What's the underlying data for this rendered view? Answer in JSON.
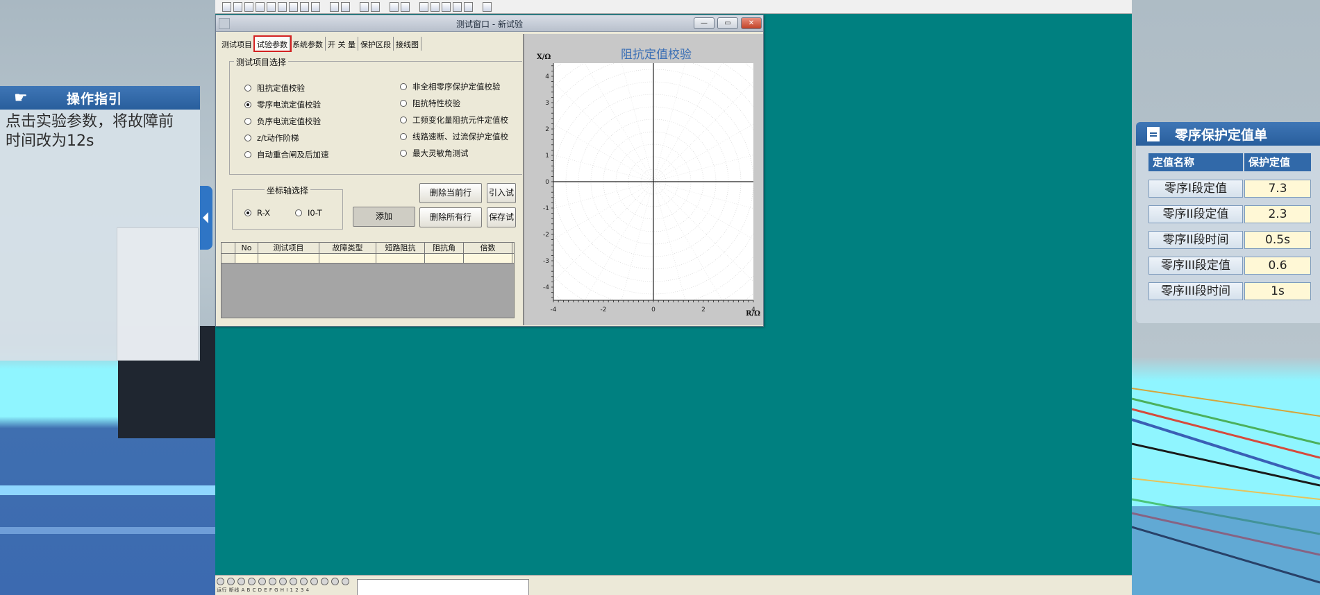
{
  "dialog": {
    "title": "测试窗口 - 新试验",
    "tabs": [
      "测试项目",
      "试验参数",
      "系统参数",
      "开 关 量",
      "保护区段",
      "接线图"
    ],
    "group_test_items": "测试项目选择",
    "left_items": [
      "阻抗定值校验",
      "零序电流定值校验",
      "负序电流定值校验",
      "z/t动作阶梯",
      "自动重合闸及后加速"
    ],
    "right_items": [
      "非全相零序保护定值校验",
      "阻抗特性校验",
      "工频变化量阻抗元件定值校",
      "线路速断、过流保护定值校",
      "最大灵敏角测试"
    ],
    "selected_item": "零序电流定值校验",
    "axis_group": "坐标轴选择",
    "axis_options": [
      "R-X",
      "I0-T"
    ],
    "buttons": {
      "add": "添加",
      "delete_current": "删除当前行",
      "delete_all": "删除所有行",
      "import": "引入试",
      "save": "保存试"
    },
    "table_headers": [
      "No",
      "测试项目",
      "故障类型",
      "短路阻抗",
      "阻抗角",
      "倍数"
    ]
  },
  "chart_data": {
    "type": "scatter",
    "title": "阻抗定值校验",
    "xlabel": "R/Ω",
    "ylabel": "X/Ω",
    "xlim": [
      -4,
      4
    ],
    "ylim": [
      -4.5,
      4.5
    ],
    "x_ticks": [
      "-4",
      "-2",
      "0",
      "2",
      "4"
    ],
    "y_ticks": [
      "4",
      "3",
      "2",
      "1",
      "0",
      "-1",
      "-2",
      "-3",
      "-4"
    ],
    "grid": "polar-dotted",
    "series": []
  },
  "guide": {
    "title": "操作指引",
    "text_line1": "点击实验参数，将故障前",
    "text_line2": "时间改为12s"
  },
  "settings": {
    "title": "零序保护定值单",
    "col_name": "定值名称",
    "col_value": "保护定值",
    "rows": [
      {
        "name": "零序I段定值",
        "value": "7.3"
      },
      {
        "name": "零序II段定值",
        "value": "2.3"
      },
      {
        "name": "零序II段时间",
        "value": "0.5s"
      },
      {
        "name": "零序III段定值",
        "value": "0.6"
      },
      {
        "name": "零序III段时间",
        "value": "1s"
      }
    ]
  },
  "statusbar": {
    "led_labels": "运行 断线 A B C D E F G H I 1 2 3 4"
  },
  "colors": {
    "desktop": "#008080",
    "header_blue": "#285e9c",
    "active_tab_outline": "#d32121",
    "chart_title": "#3b6fb5"
  }
}
